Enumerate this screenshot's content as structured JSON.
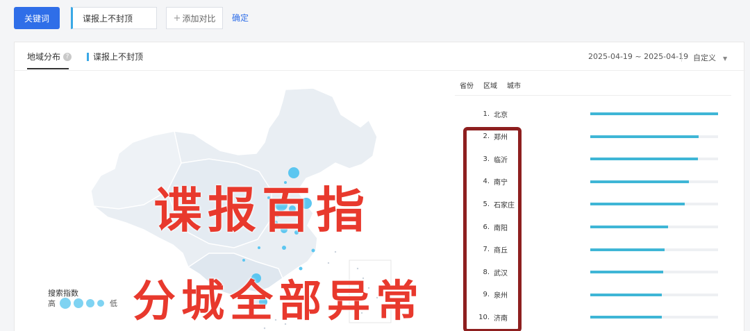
{
  "toolbar": {
    "keyword_button": "关键词",
    "keyword_value": "谍报上不封顶",
    "add_compare": "添加对比",
    "confirm": "确定"
  },
  "panel": {
    "tab_region": "地域分布",
    "tab_keyword": "谍报上不封顶",
    "date_range": "2025-04-19 ~ 2025-04-19",
    "custom_label": "自定义"
  },
  "legend": {
    "title": "搜索指数",
    "high": "高",
    "low": "低"
  },
  "scope_tabs": [
    "省份",
    "区域",
    "城市"
  ],
  "ranking": [
    {
      "rank": "1.",
      "name": "北京",
      "value": 1.0
    },
    {
      "rank": "2.",
      "name": "郑州",
      "value": 0.85
    },
    {
      "rank": "3.",
      "name": "临沂",
      "value": 0.84
    },
    {
      "rank": "4.",
      "name": "南宁",
      "value": 0.77
    },
    {
      "rank": "5.",
      "name": "石家庄",
      "value": 0.74
    },
    {
      "rank": "6.",
      "name": "南阳",
      "value": 0.61
    },
    {
      "rank": "7.",
      "name": "商丘",
      "value": 0.58
    },
    {
      "rank": "8.",
      "name": "武汉",
      "value": 0.57
    },
    {
      "rank": "9.",
      "name": "泉州",
      "value": 0.56
    },
    {
      "rank": "10.",
      "name": "济南",
      "value": 0.56
    }
  ],
  "overlay": {
    "line1": "谍报百指",
    "line2": "分城全部异常"
  },
  "colors": {
    "primary": "#2f6ee8",
    "bar": "#3fb6d6",
    "bubble": "#5cc6f0",
    "overlay": "#e8392d",
    "box": "#8e1f1f"
  }
}
